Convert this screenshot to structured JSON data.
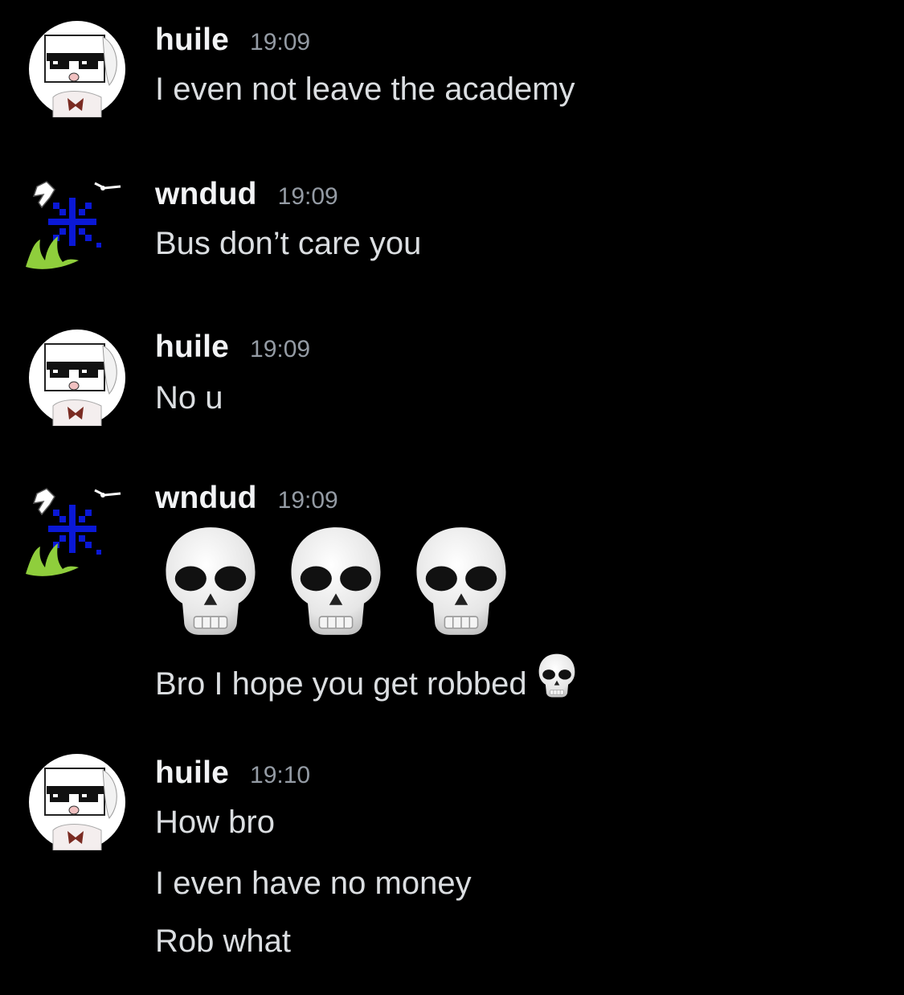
{
  "messages": [
    {
      "username": "huile",
      "time": "19:09",
      "lines": [
        "I even not leave the academy"
      ]
    },
    {
      "username": "wndud",
      "time": "19:09",
      "lines": [
        "Bus don’t care you"
      ]
    },
    {
      "username": "huile",
      "time": "19:09",
      "lines": [
        "No u"
      ]
    },
    {
      "username": "wndud",
      "time": "19:09",
      "jumbo_emoji": [
        "skull-emoji",
        "skull-emoji",
        "skull-emoji"
      ],
      "lines": [
        "Bro I hope you get robbed"
      ],
      "trailing_emoji": "skull-emoji"
    },
    {
      "username": "huile",
      "time": "19:10",
      "lines": [
        "How bro",
        "I even have no money",
        "Rob what"
      ]
    }
  ],
  "colors": {
    "background": "#000000",
    "username": "#f2f3f5",
    "timestamp": "#949ba4",
    "message_text": "#dbdee1"
  }
}
